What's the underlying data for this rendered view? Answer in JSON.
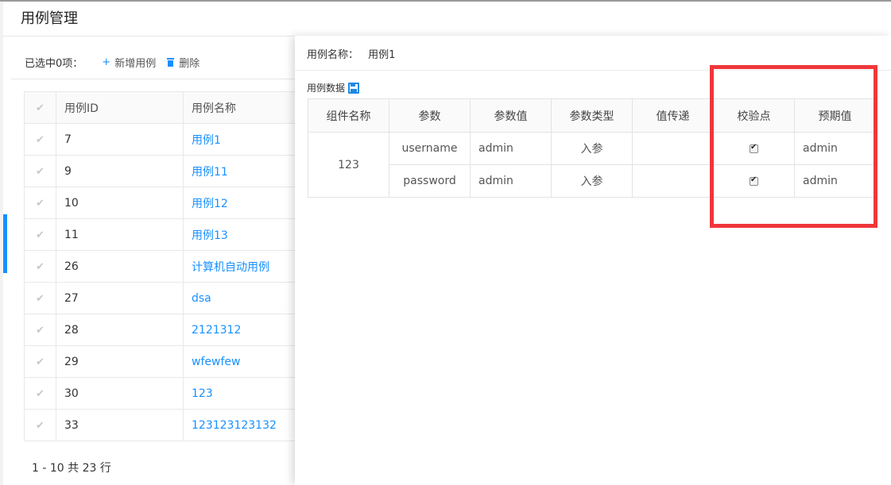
{
  "page": {
    "title": "用例管理"
  },
  "toolbar": {
    "selected_label": "已选中0项：",
    "add_label": "新增用例",
    "add_icon": "plus-icon",
    "delete_label": "删除",
    "delete_icon": "trash-icon"
  },
  "list": {
    "columns": [
      "用例ID",
      "用例名称"
    ],
    "rows": [
      {
        "id": "7",
        "name": "用例1"
      },
      {
        "id": "9",
        "name": "用例11"
      },
      {
        "id": "10",
        "name": "用例12"
      },
      {
        "id": "11",
        "name": "用例13"
      },
      {
        "id": "26",
        "name": "计算机自动用例"
      },
      {
        "id": "27",
        "name": "dsa"
      },
      {
        "id": "28",
        "name": "2121312"
      },
      {
        "id": "29",
        "name": "wfewfew"
      },
      {
        "id": "30",
        "name": "123"
      },
      {
        "id": "33",
        "name": "123123123132"
      }
    ]
  },
  "pager": {
    "text": "1 - 10 共 23 行"
  },
  "drawer": {
    "name_label": "用例名称：",
    "name_value": "用例1",
    "section_label": "用例数据",
    "section_icon": "save-icon",
    "columns": [
      "组件名称",
      "参数",
      "参数值",
      "参数类型",
      "值传递",
      "校验点",
      "预期值"
    ],
    "component": "123",
    "rows": [
      {
        "param": "username",
        "value": "admin",
        "type": "入参",
        "pass": "",
        "check": true,
        "expected": "admin"
      },
      {
        "param": "password",
        "value": "admin",
        "type": "入参",
        "pass": "",
        "check": true,
        "expected": "admin"
      }
    ]
  },
  "colors": {
    "accent": "#1890ff",
    "highlight": "#f0373b"
  }
}
